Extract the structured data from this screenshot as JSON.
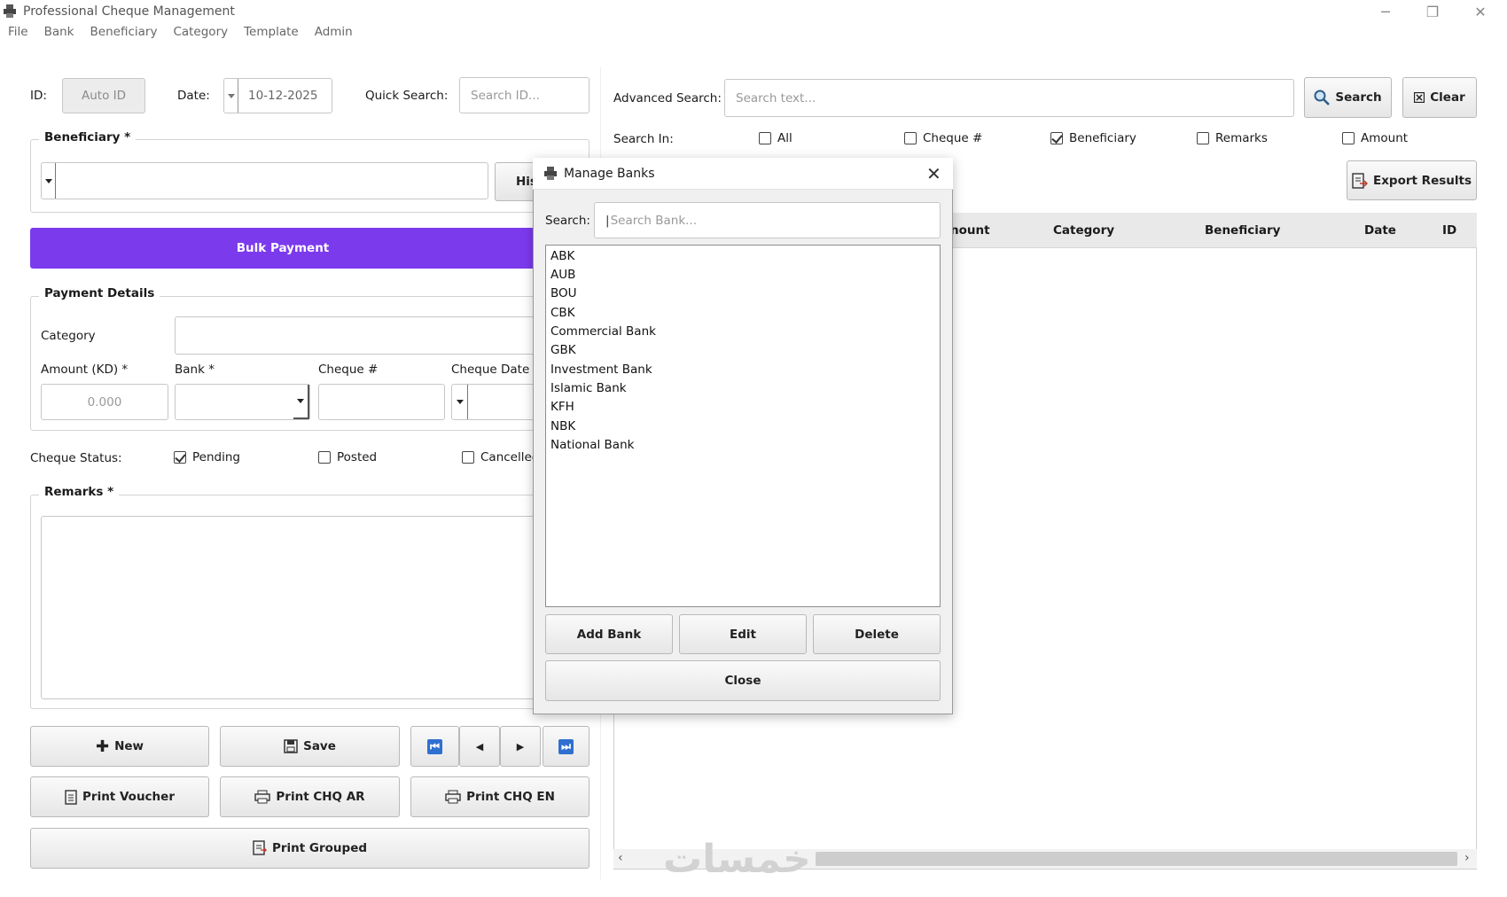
{
  "window": {
    "title": "Professional Cheque Management",
    "minimize": "─",
    "restore": "❐",
    "close": "✕"
  },
  "menu": {
    "items": [
      "File",
      "Bank",
      "Beneficiary",
      "Category",
      "Template",
      "Admin"
    ]
  },
  "form": {
    "id_label": "ID:",
    "id_placeholder": "Auto ID",
    "date_label": "Date:",
    "date_value": "10-12-2025",
    "quick_search_label": "Quick Search:",
    "quick_search_placeholder": "Search ID...",
    "beneficiary_title": "Beneficiary *",
    "history_label": "His",
    "bulk_payment": "Bulk Payment",
    "payment_details_title": "Payment Details",
    "category_label": "Category",
    "amount_label": "Amount (KD) *",
    "amount_placeholder": "0.000",
    "bank_label": "Bank *",
    "cheque_no_label": "Cheque #",
    "cheque_date_label": "Cheque Date",
    "status_label": "Cheque Status:",
    "status_pending": "Pending",
    "status_posted": "Posted",
    "status_cancelled": "Cancellec",
    "remarks_title": "Remarks *"
  },
  "buttons": {
    "new": "New",
    "save": "Save",
    "print_voucher": "Print Voucher",
    "print_chq_ar": "Print CHQ AR",
    "print_chq_en": "Print CHQ EN",
    "print_grouped": "Print Grouped",
    "first": "⏮",
    "prev": "◀",
    "next": "▶",
    "last": "⏭"
  },
  "search": {
    "advanced_label": "Advanced Search:",
    "advanced_placeholder": "Search text...",
    "search_button": "Search",
    "clear_button": "Clear",
    "search_in_label": "Search In:",
    "options": [
      {
        "label": "All",
        "checked": false
      },
      {
        "label": "Cheque #",
        "checked": false
      },
      {
        "label": "Beneficiary",
        "checked": true
      },
      {
        "label": "Remarks",
        "checked": false
      },
      {
        "label": "Amount",
        "checked": false
      }
    ],
    "export_button": "Export Results"
  },
  "grid": {
    "columns": [
      "nount",
      "Category",
      "Beneficiary",
      "Date",
      "ID"
    ]
  },
  "dialog": {
    "title": "Manage Banks",
    "search_label": "Search:",
    "search_placeholder": "Search Bank...",
    "banks": [
      "ABK",
      "AUB",
      "BOU",
      "CBK",
      "Commercial Bank",
      "GBK",
      "Investment Bank",
      "Islamic Bank",
      "KFH",
      "NBK",
      "National Bank"
    ],
    "add_button": "Add Bank",
    "edit_button": "Edit",
    "delete_button": "Delete",
    "close_button": "Close"
  },
  "watermark": "خمسات",
  "colors": {
    "accent": "#7c3aed",
    "dialog_bg": "#f0f0f0"
  }
}
